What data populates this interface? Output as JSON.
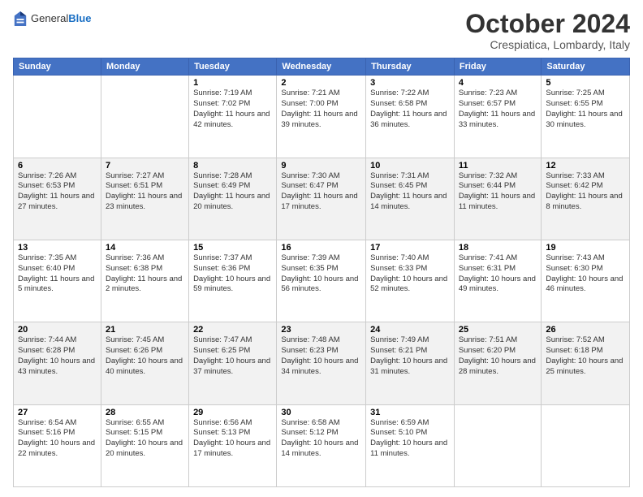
{
  "logo": {
    "general": "General",
    "blue": "Blue"
  },
  "header": {
    "month": "October 2024",
    "location": "Crespiatica, Lombardy, Italy"
  },
  "weekdays": [
    "Sunday",
    "Monday",
    "Tuesday",
    "Wednesday",
    "Thursday",
    "Friday",
    "Saturday"
  ],
  "weeks": [
    [
      {
        "day": "",
        "sunrise": "",
        "sunset": "",
        "daylight": ""
      },
      {
        "day": "",
        "sunrise": "",
        "sunset": "",
        "daylight": ""
      },
      {
        "day": "1",
        "sunrise": "Sunrise: 7:19 AM",
        "sunset": "Sunset: 7:02 PM",
        "daylight": "Daylight: 11 hours and 42 minutes."
      },
      {
        "day": "2",
        "sunrise": "Sunrise: 7:21 AM",
        "sunset": "Sunset: 7:00 PM",
        "daylight": "Daylight: 11 hours and 39 minutes."
      },
      {
        "day": "3",
        "sunrise": "Sunrise: 7:22 AM",
        "sunset": "Sunset: 6:58 PM",
        "daylight": "Daylight: 11 hours and 36 minutes."
      },
      {
        "day": "4",
        "sunrise": "Sunrise: 7:23 AM",
        "sunset": "Sunset: 6:57 PM",
        "daylight": "Daylight: 11 hours and 33 minutes."
      },
      {
        "day": "5",
        "sunrise": "Sunrise: 7:25 AM",
        "sunset": "Sunset: 6:55 PM",
        "daylight": "Daylight: 11 hours and 30 minutes."
      }
    ],
    [
      {
        "day": "6",
        "sunrise": "Sunrise: 7:26 AM",
        "sunset": "Sunset: 6:53 PM",
        "daylight": "Daylight: 11 hours and 27 minutes."
      },
      {
        "day": "7",
        "sunrise": "Sunrise: 7:27 AM",
        "sunset": "Sunset: 6:51 PM",
        "daylight": "Daylight: 11 hours and 23 minutes."
      },
      {
        "day": "8",
        "sunrise": "Sunrise: 7:28 AM",
        "sunset": "Sunset: 6:49 PM",
        "daylight": "Daylight: 11 hours and 20 minutes."
      },
      {
        "day": "9",
        "sunrise": "Sunrise: 7:30 AM",
        "sunset": "Sunset: 6:47 PM",
        "daylight": "Daylight: 11 hours and 17 minutes."
      },
      {
        "day": "10",
        "sunrise": "Sunrise: 7:31 AM",
        "sunset": "Sunset: 6:45 PM",
        "daylight": "Daylight: 11 hours and 14 minutes."
      },
      {
        "day": "11",
        "sunrise": "Sunrise: 7:32 AM",
        "sunset": "Sunset: 6:44 PM",
        "daylight": "Daylight: 11 hours and 11 minutes."
      },
      {
        "day": "12",
        "sunrise": "Sunrise: 7:33 AM",
        "sunset": "Sunset: 6:42 PM",
        "daylight": "Daylight: 11 hours and 8 minutes."
      }
    ],
    [
      {
        "day": "13",
        "sunrise": "Sunrise: 7:35 AM",
        "sunset": "Sunset: 6:40 PM",
        "daylight": "Daylight: 11 hours and 5 minutes."
      },
      {
        "day": "14",
        "sunrise": "Sunrise: 7:36 AM",
        "sunset": "Sunset: 6:38 PM",
        "daylight": "Daylight: 11 hours and 2 minutes."
      },
      {
        "day": "15",
        "sunrise": "Sunrise: 7:37 AM",
        "sunset": "Sunset: 6:36 PM",
        "daylight": "Daylight: 10 hours and 59 minutes."
      },
      {
        "day": "16",
        "sunrise": "Sunrise: 7:39 AM",
        "sunset": "Sunset: 6:35 PM",
        "daylight": "Daylight: 10 hours and 56 minutes."
      },
      {
        "day": "17",
        "sunrise": "Sunrise: 7:40 AM",
        "sunset": "Sunset: 6:33 PM",
        "daylight": "Daylight: 10 hours and 52 minutes."
      },
      {
        "day": "18",
        "sunrise": "Sunrise: 7:41 AM",
        "sunset": "Sunset: 6:31 PM",
        "daylight": "Daylight: 10 hours and 49 minutes."
      },
      {
        "day": "19",
        "sunrise": "Sunrise: 7:43 AM",
        "sunset": "Sunset: 6:30 PM",
        "daylight": "Daylight: 10 hours and 46 minutes."
      }
    ],
    [
      {
        "day": "20",
        "sunrise": "Sunrise: 7:44 AM",
        "sunset": "Sunset: 6:28 PM",
        "daylight": "Daylight: 10 hours and 43 minutes."
      },
      {
        "day": "21",
        "sunrise": "Sunrise: 7:45 AM",
        "sunset": "Sunset: 6:26 PM",
        "daylight": "Daylight: 10 hours and 40 minutes."
      },
      {
        "day": "22",
        "sunrise": "Sunrise: 7:47 AM",
        "sunset": "Sunset: 6:25 PM",
        "daylight": "Daylight: 10 hours and 37 minutes."
      },
      {
        "day": "23",
        "sunrise": "Sunrise: 7:48 AM",
        "sunset": "Sunset: 6:23 PM",
        "daylight": "Daylight: 10 hours and 34 minutes."
      },
      {
        "day": "24",
        "sunrise": "Sunrise: 7:49 AM",
        "sunset": "Sunset: 6:21 PM",
        "daylight": "Daylight: 10 hours and 31 minutes."
      },
      {
        "day": "25",
        "sunrise": "Sunrise: 7:51 AM",
        "sunset": "Sunset: 6:20 PM",
        "daylight": "Daylight: 10 hours and 28 minutes."
      },
      {
        "day": "26",
        "sunrise": "Sunrise: 7:52 AM",
        "sunset": "Sunset: 6:18 PM",
        "daylight": "Daylight: 10 hours and 25 minutes."
      }
    ],
    [
      {
        "day": "27",
        "sunrise": "Sunrise: 6:54 AM",
        "sunset": "Sunset: 5:16 PM",
        "daylight": "Daylight: 10 hours and 22 minutes."
      },
      {
        "day": "28",
        "sunrise": "Sunrise: 6:55 AM",
        "sunset": "Sunset: 5:15 PM",
        "daylight": "Daylight: 10 hours and 20 minutes."
      },
      {
        "day": "29",
        "sunrise": "Sunrise: 6:56 AM",
        "sunset": "Sunset: 5:13 PM",
        "daylight": "Daylight: 10 hours and 17 minutes."
      },
      {
        "day": "30",
        "sunrise": "Sunrise: 6:58 AM",
        "sunset": "Sunset: 5:12 PM",
        "daylight": "Daylight: 10 hours and 14 minutes."
      },
      {
        "day": "31",
        "sunrise": "Sunrise: 6:59 AM",
        "sunset": "Sunset: 5:10 PM",
        "daylight": "Daylight: 10 hours and 11 minutes."
      },
      {
        "day": "",
        "sunrise": "",
        "sunset": "",
        "daylight": ""
      },
      {
        "day": "",
        "sunrise": "",
        "sunset": "",
        "daylight": ""
      }
    ]
  ],
  "row_classes": [
    "row-odd",
    "row-even",
    "row-odd",
    "row-even",
    "row-odd"
  ]
}
